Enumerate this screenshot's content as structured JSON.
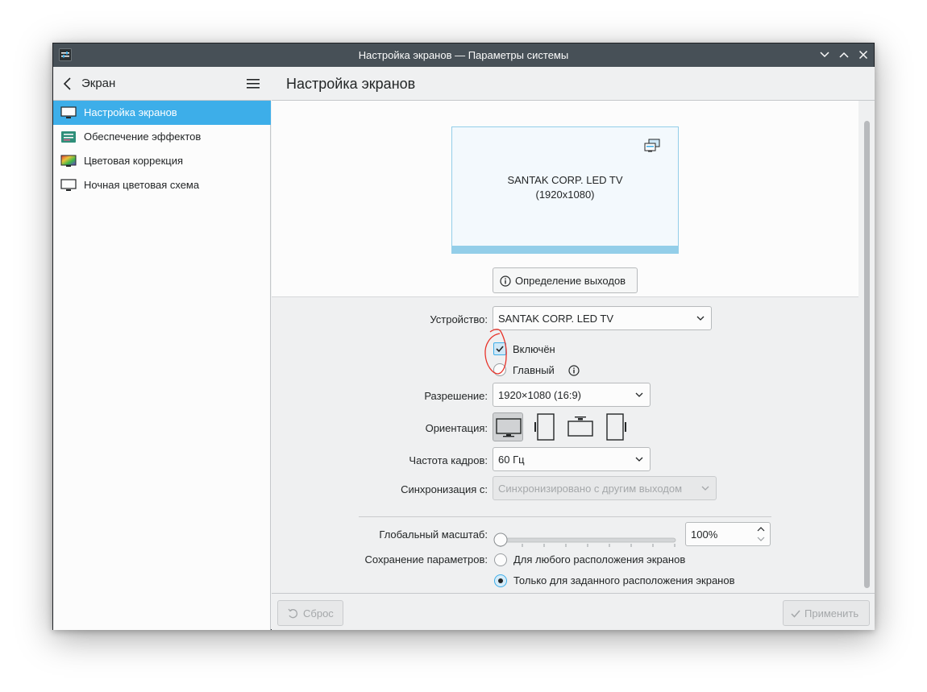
{
  "window": {
    "title": "Настройка экранов — Параметры системы"
  },
  "sidebar": {
    "back_label": "Экран",
    "items": [
      {
        "label": "Настройка экранов",
        "icon": "monitor-icon",
        "active": true
      },
      {
        "label": "Обеспечение эффектов",
        "icon": "compositor-icon",
        "active": false
      },
      {
        "label": "Цветовая коррекция",
        "icon": "color-correction-icon",
        "active": false
      },
      {
        "label": "Ночная цветовая схема",
        "icon": "monitor-icon",
        "active": false
      }
    ]
  },
  "main": {
    "heading": "Настройка экранов",
    "preview": {
      "screen_name": "SANTAK CORP. LED TV",
      "screen_resolution": "(1920x1080)",
      "identify_button": "Определение выходов"
    },
    "form": {
      "device_label": "Устройство:",
      "device_value": "SANTAK CORP. LED TV",
      "enabled_label": "Включён",
      "enabled": true,
      "primary_label": "Главный",
      "primary": false,
      "resolution_label": "Разрешение:",
      "resolution_value": "1920×1080 (16:9)",
      "orientation_label": "Ориентация:",
      "orientation_selected": "landscape",
      "refresh_label": "Частота кадров:",
      "refresh_value": "60 Гц",
      "sync_label": "Синхронизация с:",
      "sync_value": "Синхронизировано с другим выходом",
      "scale_label": "Глобальный масштаб:",
      "scale_value": "100%",
      "scale_level": 0,
      "save_label": "Сохранение параметров:",
      "save_options": [
        {
          "label": "Для любого расположения экранов",
          "selected": false
        },
        {
          "label": "Только для заданного расположения экранов",
          "selected": true
        }
      ]
    }
  },
  "footer": {
    "reset_label": "Сброс",
    "apply_label": "Применить"
  },
  "colors": {
    "accent": "#3daee9",
    "titlebar": "#475057",
    "annotation": "#e8332a"
  }
}
